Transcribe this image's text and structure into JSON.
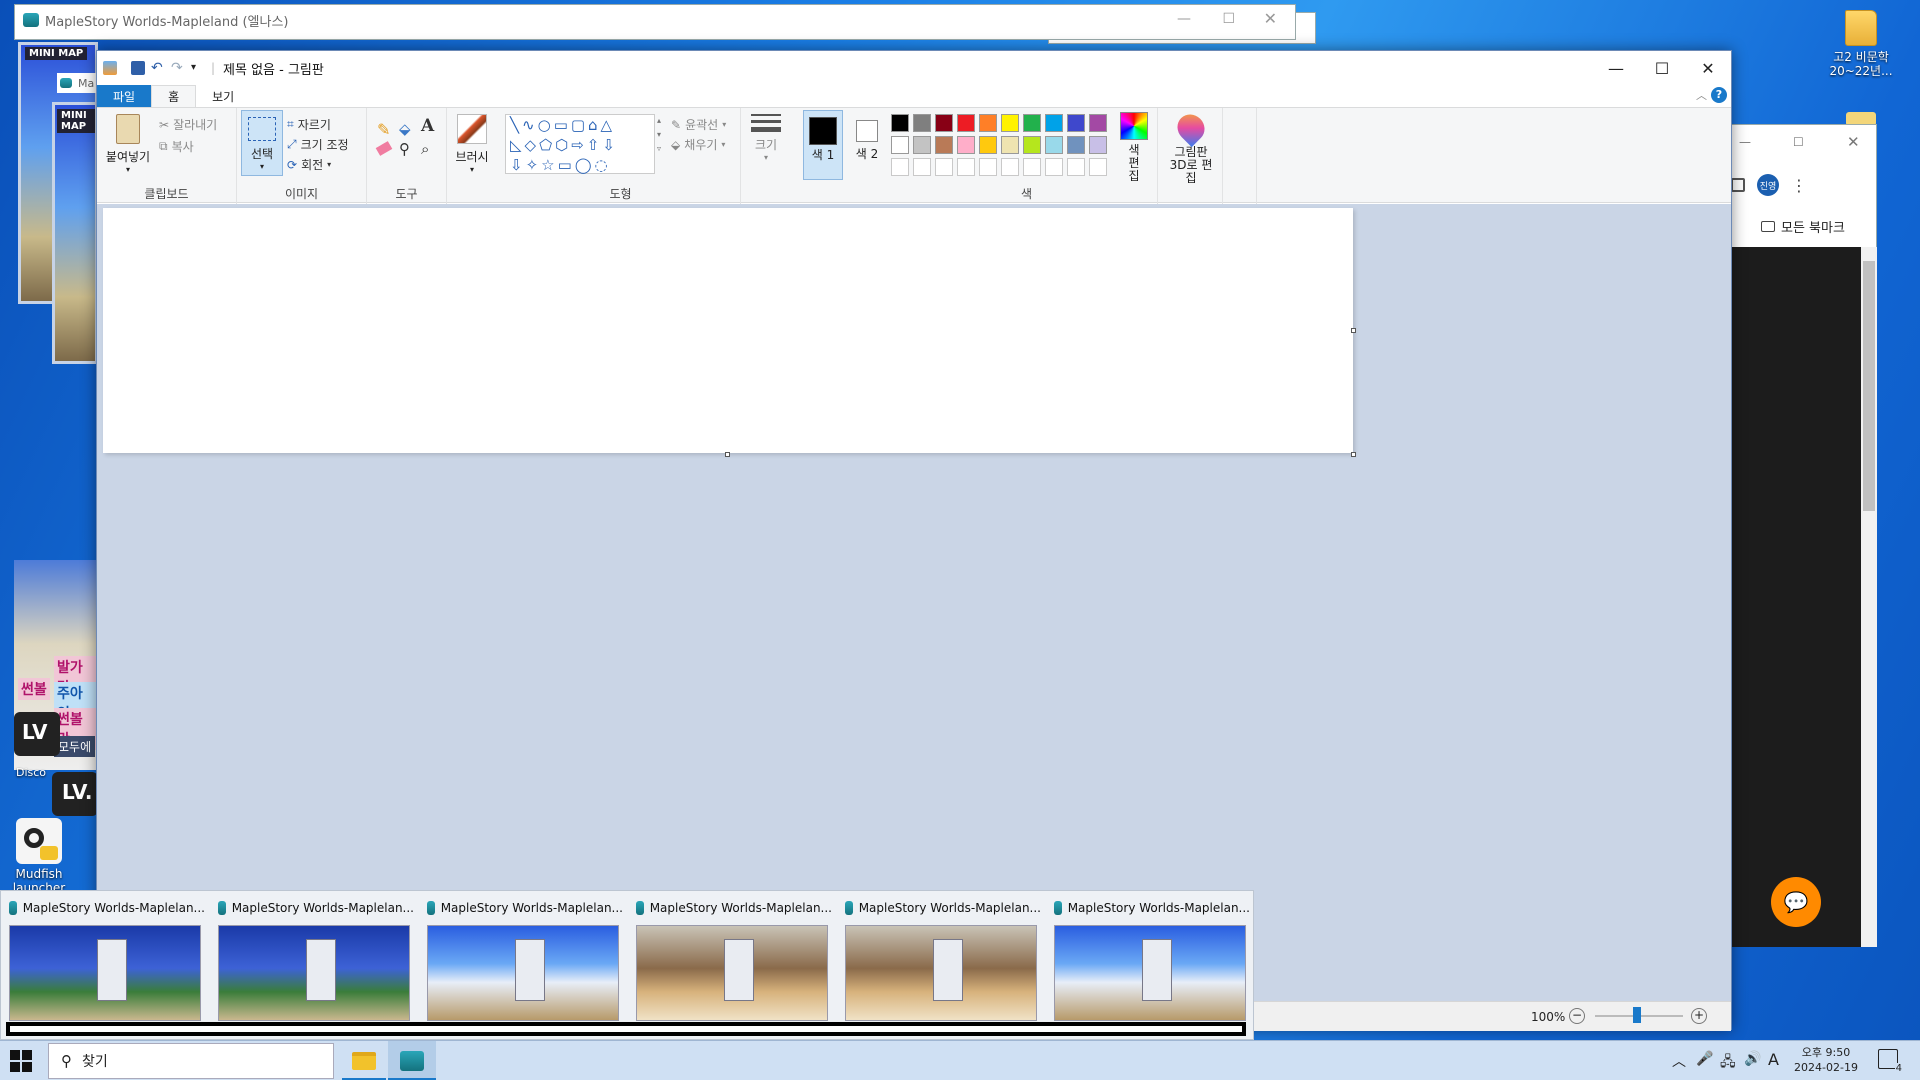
{
  "desktop": {
    "icons": [
      {
        "label": "고2 비문학 20~22년..."
      },
      {
        "label": "Mudfish launcher"
      }
    ],
    "side_labels": [
      "발가락",
      "썬볼",
      "주아인",
      "썬볼만",
      "모두에",
      "LV",
      "LV.",
      "Disco"
    ]
  },
  "bg_windows": {
    "maple_title": "MapleStory Worlds-Mapleland (엘나스)",
    "maple_title_short": "Ma",
    "minimap_label": "MINI MAP"
  },
  "paint": {
    "title": "제목 없음 - 그림판",
    "tabs": {
      "file": "파일",
      "home": "홈",
      "view": "보기"
    },
    "clipboard": {
      "paste": "붙여넣기",
      "cut": "잘라내기",
      "copy": "복사",
      "label": "클립보드"
    },
    "image": {
      "select": "선택",
      "crop": "자르기",
      "resize": "크기 조정",
      "rotate": "회전",
      "label": "이미지"
    },
    "tools": {
      "label": "도구"
    },
    "brushes": {
      "label": "브러시"
    },
    "shapes": {
      "outline": "윤곽선",
      "fill": "채우기",
      "label": "도형"
    },
    "size": {
      "label": "크기"
    },
    "colors": {
      "color1": "색 1",
      "color2": "색 2",
      "edit": "색 편집",
      "label": "색",
      "row1": [
        "#000000",
        "#7f7f7f",
        "#880015",
        "#ed1c24",
        "#ff7f27",
        "#fff200",
        "#22b14c",
        "#00a2e8",
        "#3f48cc",
        "#a349a4"
      ],
      "row2": [
        "#ffffff",
        "#c3c3c3",
        "#b97a57",
        "#ffaec9",
        "#ffc90e",
        "#efe4b0",
        "#b5e61d",
        "#99d9ea",
        "#7092be",
        "#c8bfe7"
      ]
    },
    "paint3d": "그림판 3D로 편집",
    "zoom": "100%"
  },
  "browser": {
    "bookmarks": "모든 북마크",
    "profile": "진영"
  },
  "previews": [
    {
      "title": "MapleStory Worlds-Maplelan..."
    },
    {
      "title": "MapleStory Worlds-Maplelan..."
    },
    {
      "title": "MapleStory Worlds-Maplelan..."
    },
    {
      "title": "MapleStory Worlds-Maplelan..."
    },
    {
      "title": "MapleStory Worlds-Maplelan..."
    },
    {
      "title": "MapleStory Worlds-Maplelan..."
    }
  ],
  "taskbar": {
    "search_placeholder": "찾기",
    "time": "오후 9:50",
    "date": "2024-02-19",
    "ime": "A",
    "notif_count": "4"
  }
}
